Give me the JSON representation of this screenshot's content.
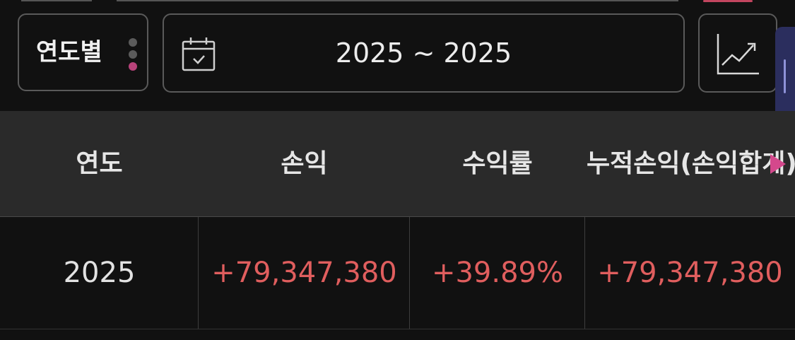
{
  "filters": {
    "period_label": "연도별",
    "date_range": "2025 ~ 2025"
  },
  "icons": {
    "calendar": "calendar-icon",
    "chart": "line-chart-icon",
    "menu_dots": "vertical-dots-icon",
    "scroll_right": "triangle-right-icon"
  },
  "table": {
    "headers": [
      "연도",
      "손익",
      "수익률",
      "누적손익(손익합계)"
    ],
    "rows": [
      {
        "year": "2025",
        "profit_loss": "+79,347,380",
        "return_rate": "+39.89%",
        "cumulative": "+79,347,380"
      }
    ]
  },
  "colors": {
    "background": "#111111",
    "header_bg": "#2a2a2a",
    "positive": "#e05e5e",
    "accent_pink": "#d4488c",
    "side_tab": "#2b2e5e"
  }
}
